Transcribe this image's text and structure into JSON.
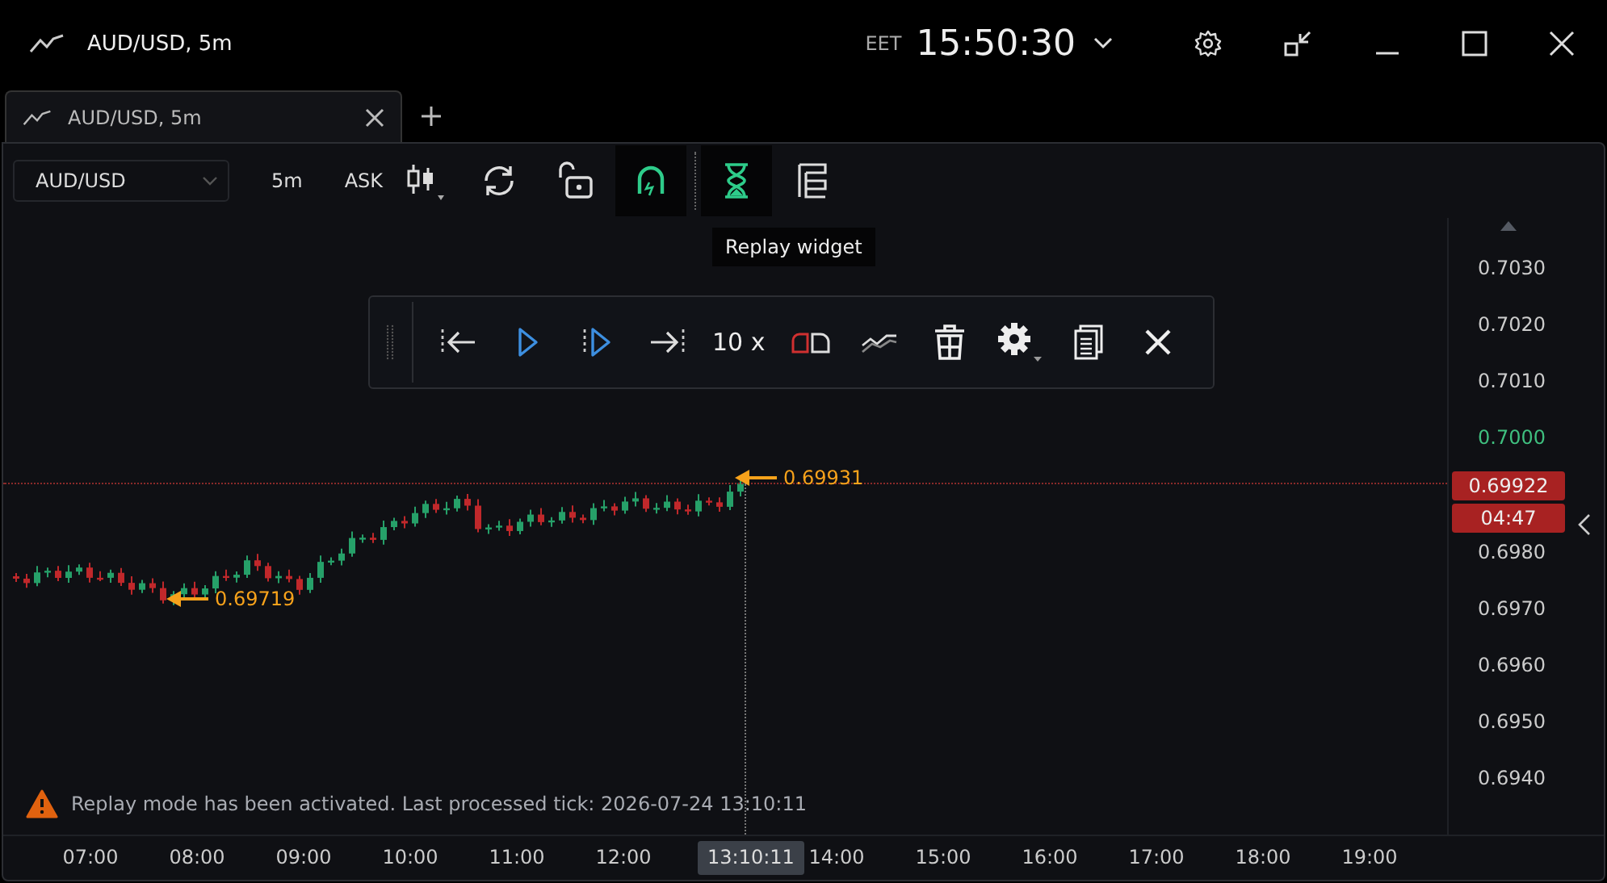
{
  "window": {
    "title": "AUD/USD, 5m",
    "timezone": "EET",
    "clock": "15:50:30"
  },
  "tabs": [
    {
      "label": "AUD/USD, 5m",
      "selected": true
    }
  ],
  "toolbar": {
    "symbol": "AUD/USD",
    "timeframe": "5m",
    "price_side": "ASK",
    "tools": [
      {
        "kind": "chart-type",
        "active": false
      },
      {
        "kind": "sync",
        "active": false
      },
      {
        "kind": "lock",
        "active": false
      },
      {
        "kind": "magnet",
        "active": true
      },
      {
        "kind": "replay",
        "active": true
      },
      {
        "kind": "layout",
        "active": false
      }
    ]
  },
  "tooltip": "Replay widget",
  "replay_widget": {
    "speed": "10 x",
    "controls": [
      {
        "kind": "start"
      },
      {
        "kind": "play"
      },
      {
        "kind": "step"
      },
      {
        "kind": "end"
      },
      {
        "kind": "speed"
      },
      {
        "kind": "toggle"
      },
      {
        "kind": "lines"
      },
      {
        "kind": "delete"
      },
      {
        "kind": "settings"
      },
      {
        "kind": "copy"
      },
      {
        "kind": "close"
      }
    ]
  },
  "price_axis": {
    "labels": [
      {
        "text": "0.7030",
        "highlighted": false
      },
      {
        "text": "0.7020",
        "highlighted": false
      },
      {
        "text": "0.7010",
        "highlighted": false
      },
      {
        "text": "0.7000",
        "highlighted": true
      },
      {
        "text": "0.6980",
        "highlighted": false
      },
      {
        "text": "0.6970",
        "highlighted": false
      },
      {
        "text": "0.6960",
        "highlighted": false
      },
      {
        "text": "0.6950",
        "highlighted": false
      },
      {
        "text": "0.6940",
        "highlighted": false
      }
    ],
    "current_price": "0.69922",
    "countdown": "04:47"
  },
  "annotations": {
    "high": "0.69931",
    "low": "0.69719"
  },
  "notice": "Replay mode has been activated. Last processed tick: 2026-07-24 13:10:11",
  "time_axis": {
    "labels": [
      "07:00",
      "08:00",
      "09:00",
      "10:00",
      "11:00",
      "12:00",
      "14:00",
      "15:00",
      "16:00",
      "17:00",
      "18:00",
      "19:00"
    ],
    "cursor_label": "13:10:11"
  }
}
